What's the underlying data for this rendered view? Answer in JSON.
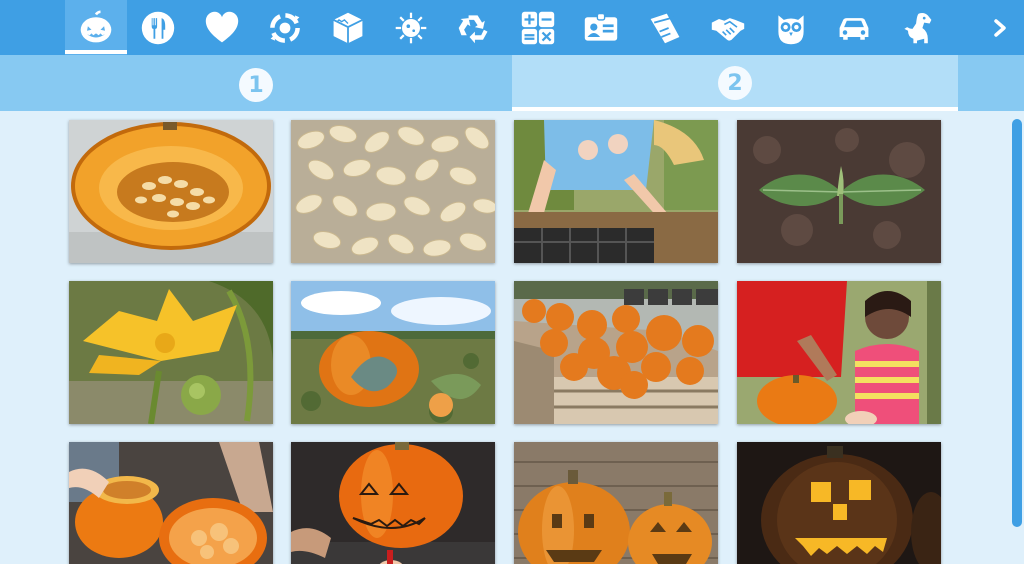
{
  "toolbar": {
    "categories": [
      {
        "icon": "pumpkin-icon",
        "active": true
      },
      {
        "icon": "fork-knife-icon",
        "active": false
      },
      {
        "icon": "heart-icon",
        "active": false
      },
      {
        "icon": "cycle-icon",
        "active": false
      },
      {
        "icon": "cube-icon",
        "active": false
      },
      {
        "icon": "germ-icon",
        "active": false
      },
      {
        "icon": "recycle-icon",
        "active": false
      },
      {
        "icon": "math-symbols-icon",
        "active": false
      },
      {
        "icon": "id-card-icon",
        "active": false
      },
      {
        "icon": "tools-icon",
        "active": false
      },
      {
        "icon": "handshake-icon",
        "active": false
      },
      {
        "icon": "owl-icon",
        "active": false
      },
      {
        "icon": "car-icon",
        "active": false
      },
      {
        "icon": "dog-icon",
        "active": false
      }
    ],
    "next_icon": "chevron-right-icon"
  },
  "tabs": [
    {
      "label": "1",
      "active": false
    },
    {
      "label": "2",
      "active": true
    }
  ],
  "images": [
    "pumpkin-halved-seeds",
    "pumpkin-seeds-pile",
    "child-planting-seeds",
    "pumpkin-seedling",
    "pumpkin-flower",
    "pumpkin-in-field",
    "harvested-pumpkins-crate",
    "children-with-pumpkin",
    "scooping-pumpkin",
    "drawing-face-on-pumpkin",
    "carved-pumpkins",
    "lit-jack-o-lantern"
  ],
  "colors": {
    "toolbar": "#3f9fe4",
    "tabbar": "#87c9f2",
    "active_tab": "#b2def8",
    "background": "#dff0fb",
    "scrollbar": "#3f9fe4"
  }
}
